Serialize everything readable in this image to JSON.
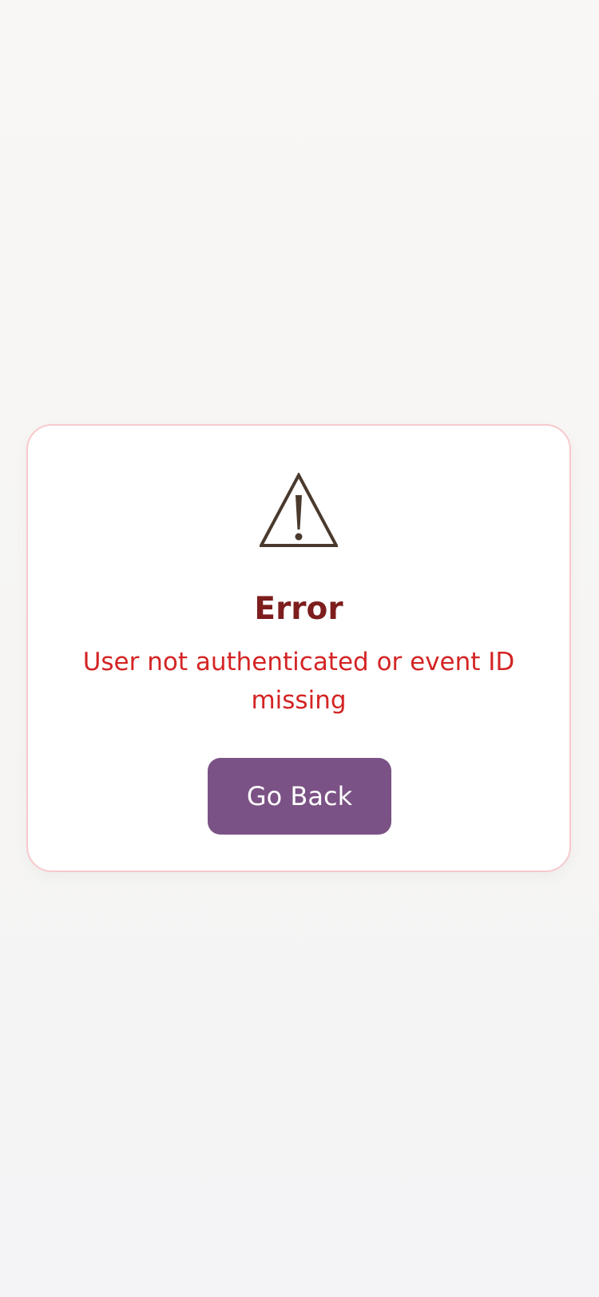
{
  "error": {
    "icon": "warning-triangle-icon",
    "title": "Error",
    "message": "User not authenticated or event ID missing",
    "button_label": "Go Back"
  },
  "colors": {
    "title": "#7e1d1d",
    "message": "#d42424",
    "button_bg": "#7b5285",
    "card_border": "#f7c9cc",
    "icon_stroke": "#4a3a2d"
  }
}
